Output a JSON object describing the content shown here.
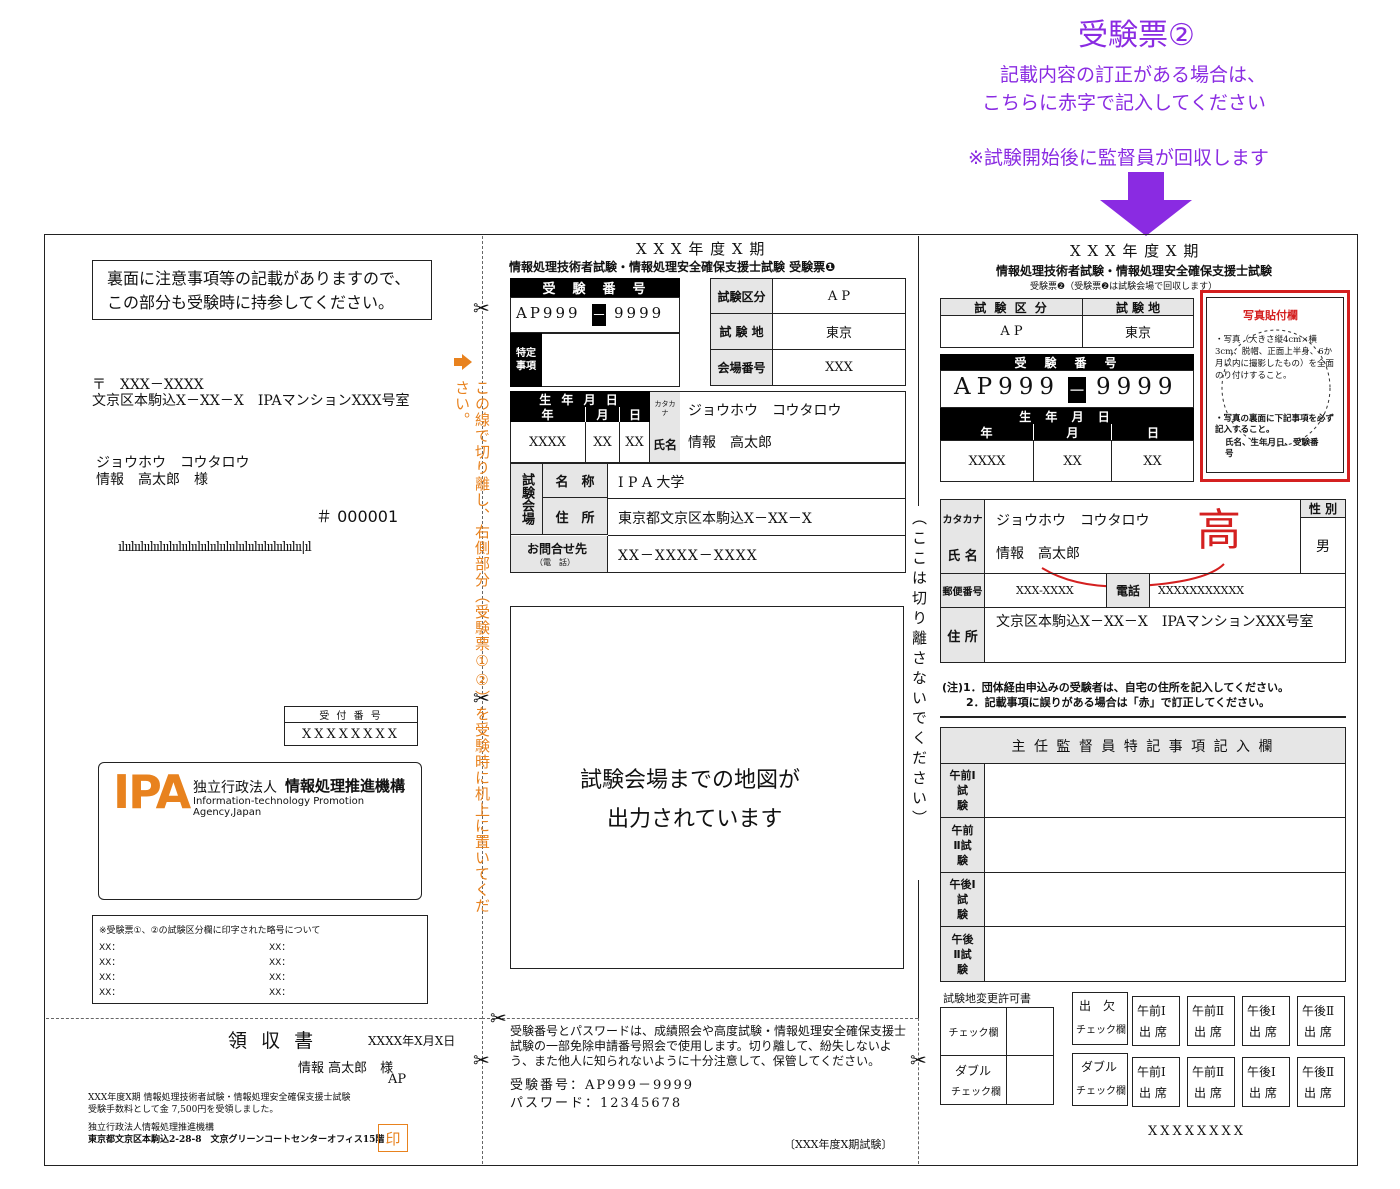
{
  "header": {
    "title": "受験票②",
    "note_line1": "記載内容の訂正がある場合は、",
    "note_line2": "こちらに赤字で記入してください",
    "note_collect": "※試験開始後に監督員が回収します"
  },
  "left": {
    "notice_line1": "裏面に注意事項等の記載がありますので、",
    "notice_line2": "この部分も受験時に持参してください。",
    "postal": "〒　XXX－XXXX",
    "address": "文京区本駒込X－XX－X　IPAマンションXXX号室",
    "name_kana": "ジョウホウ　コウタロウ",
    "name_kanji": "情報　高太郎　様",
    "serial": "＃ 000001",
    "barcode": "ılıılıılıılıılıılıılıılıılıılıılıılıılıılıılıılıılıılıılıı|ıl",
    "receipt_no_label": "受 付 番 号",
    "receipt_no_value": "XXXXXXXX",
    "ipa_logo": "IPA",
    "ipa_org_prefix": "独立行政法人",
    "ipa_org_name": "情報処理推進機構",
    "ipa_org_en": "Information-technology Promotion Agency,Japan",
    "code_note_title": "※受験票①、②の試験区分欄に印字された略号について",
    "code_rows": [
      "XX：",
      "XX：",
      "XX：",
      "XX：",
      "XX：",
      "XX：",
      "XX：",
      "XX："
    ]
  },
  "cut_text": "この線で切り離し、右側部分（受験票①②）を受験時に机上に置いてください。",
  "keep_text": "（ここは切り離さないでください）",
  "receipt": {
    "title": "領 収 書",
    "date": "XXXX年X月X日",
    "name": "情報 高太郎　様",
    "category": "AP",
    "text_line1": "XXX年度X期 情報処理技術者試験・情報処理安全確保支援士試験",
    "text_line2": "受験手数料として金 7,500円を受領しました。",
    "issuer_line1": "独立行政法人情報処理推進機構",
    "issuer_line2": "東京都文京区本駒込2-28-8　文京グリーンコートセンターオフィス15階",
    "seal": "印"
  },
  "ticket1": {
    "period": "X X X 年 度 X 期",
    "title": "情報処理技術者試験・情報処理安全確保支援士試験  受験票❶",
    "exam_no_label": "受　験　番　号",
    "exam_no_left": "AP999",
    "exam_no_dash": "－",
    "exam_no_right": "9999",
    "special_label": "特定事項",
    "category_label": "試験区分",
    "category_value": "A P",
    "site_label": "試 験 地",
    "site_value": "東京",
    "hall_no_label": "会場番号",
    "hall_no_value": "XXX",
    "dob_label": "生 年 月 日",
    "year_label": "年",
    "month_label": "月",
    "day_label": "日",
    "year_value": "XXXX",
    "month_value": "XX",
    "day_value": "XX",
    "kana_label": "カタカナ",
    "kana_value": "ジョウホウ　コウタロウ",
    "name_label": "氏名",
    "name_value": "情報　高太郎",
    "venue_label": "試験会場",
    "venue_name_label": "名　称",
    "venue_name_value": "I P A 大学",
    "venue_addr_label": "住　所",
    "venue_addr_value": "東京都文京区本駒込X－XX－X",
    "contact_label": "お問合せ先",
    "contact_sub": "（電　話）",
    "contact_value": "XX－XXXX－XXXX",
    "map_line1": "試験会場までの地図が",
    "map_line2": "出力されています",
    "pw_text": "受験番号とパスワードは、成績照会や高度試験・情報処理安全確保支援士試験の一部免除申請番号照会で使用します。切り離して、紛失しないよう、また他人に知られないように十分注意して、保管してください。",
    "pw_exam_no": "受験番号：AP999－9999",
    "pw_password": "パスワード：12345678",
    "footer": "〔XXX年度X期試験〕"
  },
  "ticket2": {
    "period": "X X X 年 度 X 期",
    "title": "情報処理技術者試験・情報処理安全確保支援士試験",
    "subtitle": "受験票❷（受験票❷は試験会場で回収します）",
    "category_label": "試 験 区 分",
    "site_label": "試 験 地",
    "category_value": "A P",
    "site_value": "東京",
    "exam_no_label": "受　験　番　号",
    "exam_no_left": "AP999",
    "exam_no_dash": "－",
    "exam_no_right": "9999",
    "dob_label": "生 年 月 日",
    "year_label": "年",
    "month_label": "月",
    "day_label": "日",
    "year_value": "XXXX",
    "month_value": "XX",
    "day_value": "XX",
    "photo_title": "写真貼付欄",
    "photo_line1": "・写真（大きさ縦4cm×横3cm、脱帽、正面上半身、6か月以内に撮影したもの）を全面のり付けすること。",
    "photo_line2": "・写真の裏面に下記事項を必ず記入すること。",
    "photo_line3": "氏名、生年月日、受験番号",
    "kana_label": "カタカナ",
    "kana_value": "ジョウホウ　コウタロウ",
    "name_label": "氏 名",
    "name_value": "情報　高太郎",
    "correction": "高",
    "sex_label": "性 別",
    "sex_value": "男",
    "postal_label": "郵便番号",
    "postal_value": "XXX-XXXX",
    "tel_label": "電話",
    "tel_value": "XXXXXXXXXXX",
    "addr_label": "住 所",
    "addr_value": "文京区本駒込X－XX－X　IPAマンションXXX号室",
    "note1": "(注)1．団体経由申込みの受験者は、自宅の住所を記入してください。",
    "note2": "2．記載事項に誤りがある場合は「赤」で訂正してください。",
    "supervisor_title": "主 任 監 督 員 特 記 事 項 記 入 欄",
    "sessions": [
      "午前Ⅰ試　験",
      "午前Ⅱ試　験",
      "午後Ⅰ試　験",
      "午後Ⅱ試　験"
    ],
    "site_change_label": "試験地変更許可書",
    "check_label": "チェック欄",
    "double_label": "ダブル",
    "attendance_label": "出　欠",
    "att_cols": [
      "午前Ⅰ",
      "午前Ⅱ",
      "午後Ⅰ",
      "午後Ⅱ"
    ],
    "att_cell_sub": "出 席",
    "footer_code": "XXXXXXXX"
  }
}
